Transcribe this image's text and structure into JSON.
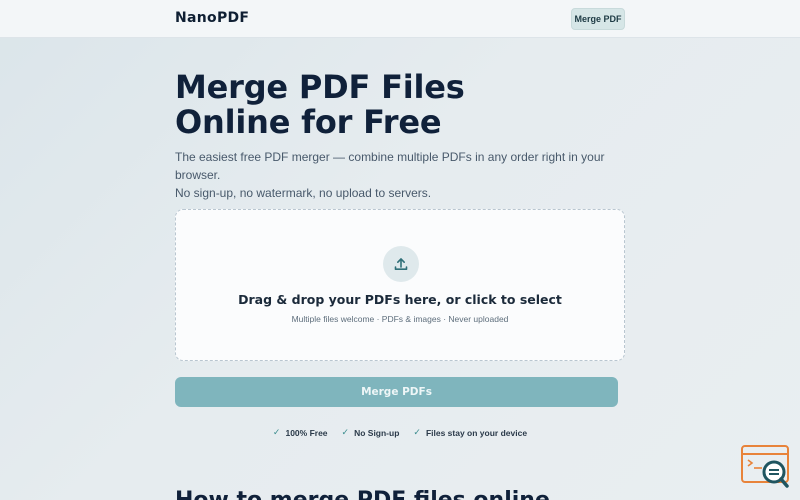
{
  "header": {
    "logo": "NanoPDF",
    "nav_button": "Merge PDF"
  },
  "hero": {
    "title_line1": "Merge PDF Files",
    "title_line2": "Online for Free",
    "subtitle_line1": "The easiest free PDF merger — combine multiple PDFs in any order right in your browser.",
    "subtitle_line2": "No sign-up, no watermark, no upload to servers."
  },
  "dropzone": {
    "icon": "upload-icon",
    "title": "Drag & drop your PDFs here, or click to select",
    "subtitle": "Multiple files welcome · PDFs & images · Never uploaded"
  },
  "merge_button": "Merge PDFs",
  "features": [
    {
      "label": "100% Free"
    },
    {
      "label": "No Sign-up"
    },
    {
      "label": "Files stay on your device"
    }
  ],
  "section_heading": "How to merge PDF files online",
  "colors": {
    "accent": "#7fb5bd",
    "check": "#3b8c8e",
    "widget": "#e8833a"
  }
}
